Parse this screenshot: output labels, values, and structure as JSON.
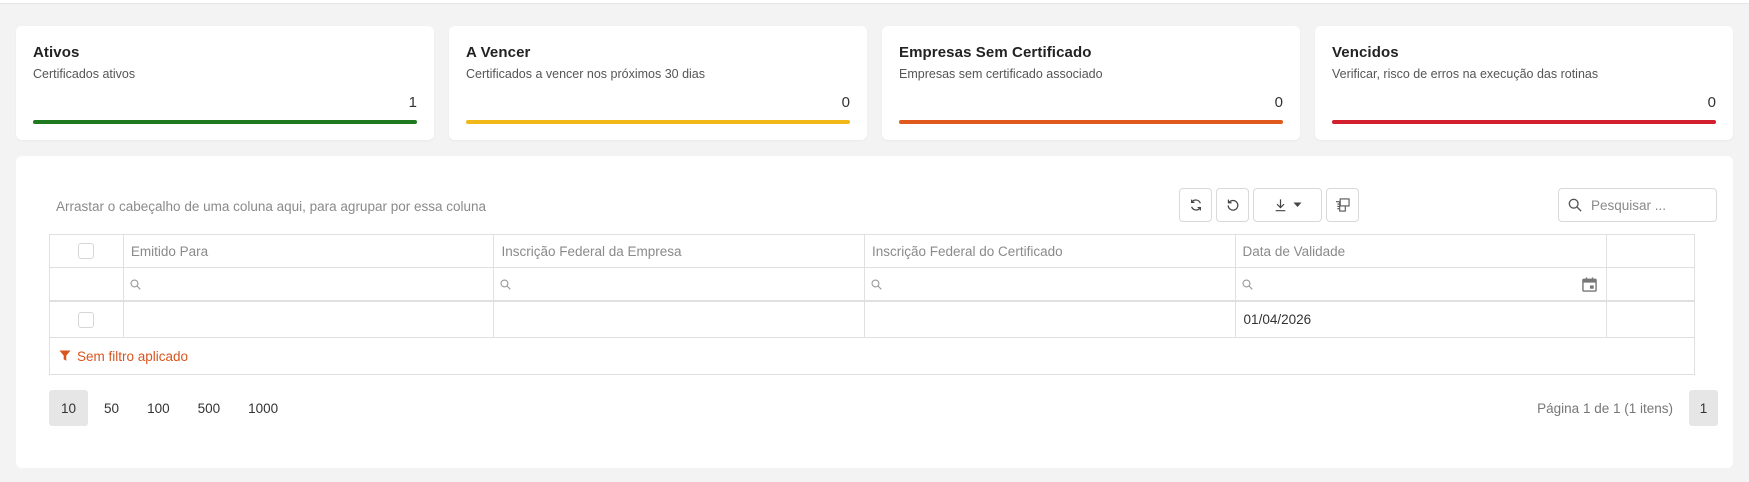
{
  "cards": [
    {
      "title": "Ativos",
      "subtitle": "Certificados ativos",
      "value": "1",
      "color": "#1f7a1f"
    },
    {
      "title": "A Vencer",
      "subtitle": "Certificados a vencer nos próximos 30 dias",
      "value": "0",
      "color": "#f2b81a"
    },
    {
      "title": "Empresas Sem Certificado",
      "subtitle": "Empresas sem certificado associado",
      "value": "0",
      "color": "#e05a1e"
    },
    {
      "title": "Vencidos",
      "subtitle": "Verificar, risco de erros na execução das rotinas",
      "value": "0",
      "color": "#d11f2d"
    }
  ],
  "grid": {
    "group_hint": "Arrastar o cabeçalho de uma coluna aqui, para agrupar por essa coluna",
    "search_placeholder": "Pesquisar ...",
    "columns": [
      "Emitido Para",
      "Inscrição Federal da Empresa",
      "Inscrição Federal do Certificado",
      "Data de Validade"
    ],
    "rows": [
      {
        "emitido_para": "",
        "inscricao_empresa": "",
        "inscricao_certificado": "",
        "data_validade": "01/04/2026"
      }
    ],
    "filter_status": "Sem filtro aplicado",
    "icons": [
      "refresh-icon",
      "reset-icon",
      "download-icon",
      "chevron-down-icon",
      "column-chooser-icon",
      "search-icon",
      "calendar-icon",
      "filter-icon"
    ]
  },
  "pager": {
    "page_sizes": [
      "10",
      "50",
      "100",
      "500",
      "1000"
    ],
    "selected_size": "10",
    "info": "Página 1 de 1 (1 itens)",
    "current_page": "1"
  }
}
